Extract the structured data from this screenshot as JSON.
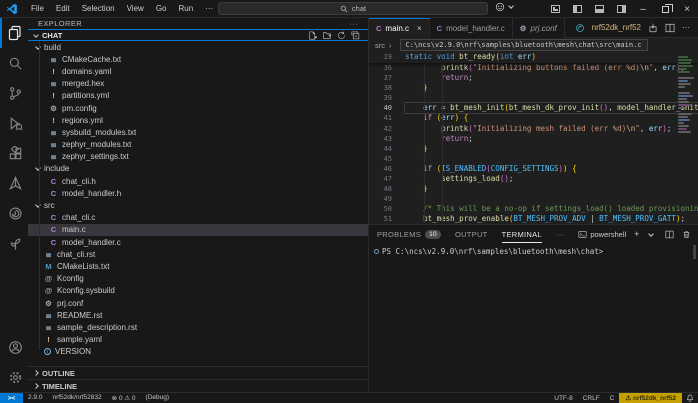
{
  "icons": {
    "more": "···",
    "close": "×",
    "back": "←",
    "forward": "→",
    "minimize": "–",
    "crumb_chevron": "›",
    "plus": "+",
    "remote": "><"
  },
  "title_bar": {
    "menus": [
      "File",
      "Edit",
      "Selection",
      "View",
      "Go",
      "Run"
    ],
    "search_value": "chat"
  },
  "explorer": {
    "title": "EXPLORER",
    "section": "CHAT",
    "outline": "OUTLINE",
    "timeline": "TIMELINE",
    "tree": [
      {
        "label": "build",
        "kind": "folder",
        "depth": 1
      },
      {
        "label": "CMakeCache.txt",
        "icon": "file",
        "depth": 2
      },
      {
        "label": "domains.yaml",
        "icon": "excl",
        "depth": 2
      },
      {
        "label": "merged.hex",
        "icon": "file",
        "depth": 2
      },
      {
        "label": "partitions.yml",
        "icon": "excl",
        "depth": 2
      },
      {
        "label": "pm.config",
        "icon": "gear",
        "depth": 2
      },
      {
        "label": "regions.yml",
        "icon": "excl",
        "depth": 2
      },
      {
        "label": "sysbuild_modules.txt",
        "icon": "file",
        "depth": 2
      },
      {
        "label": "zephyr_modules.txt",
        "icon": "file",
        "depth": 2
      },
      {
        "label": "zephyr_settings.txt",
        "icon": "file",
        "depth": 2
      },
      {
        "label": "include",
        "kind": "folder",
        "depth": 1
      },
      {
        "label": "chat_cli.h",
        "icon": "c",
        "depth": 2
      },
      {
        "label": "model_handler.h",
        "icon": "c",
        "depth": 2
      },
      {
        "label": "src",
        "kind": "folder",
        "depth": 1
      },
      {
        "label": "chat_cli.c",
        "icon": "c",
        "depth": 2
      },
      {
        "label": "main.c",
        "icon": "c",
        "depth": 2,
        "selected": true
      },
      {
        "label": "model_handler.c",
        "icon": "c",
        "depth": 2
      },
      {
        "label": "chat_cli.rst",
        "icon": "file",
        "depth": 1
      },
      {
        "label": "CMakeLists.txt",
        "icon": "cmake",
        "depth": 1
      },
      {
        "label": "Kconfig",
        "icon": "kcfg",
        "depth": 1
      },
      {
        "label": "Kconfig.sysbuild",
        "icon": "kcfg",
        "depth": 1
      },
      {
        "label": "prj.conf",
        "icon": "gear",
        "depth": 1
      },
      {
        "label": "README.rst",
        "icon": "file",
        "depth": 1
      },
      {
        "label": "sample_description.rst",
        "icon": "file",
        "depth": 1
      },
      {
        "label": "sample.yaml",
        "icon": "excl",
        "depth": 1
      },
      {
        "label": "VERSION",
        "icon": "info",
        "depth": 1
      }
    ]
  },
  "tabs": {
    "items": [
      {
        "label": "main.c",
        "icon": "c",
        "active": true
      },
      {
        "label": "model_handler.c",
        "icon": "c"
      },
      {
        "label": "prj.conf",
        "icon": "gear",
        "preview": true
      }
    ],
    "board": "nrf52dk_nrf52"
  },
  "breadcrumb": {
    "folder": "src",
    "path": "C:\\ncs\\v2.9.0\\nrf\\samples\\bluetooth\\mesh\\chat\\src\\main.c"
  },
  "editor": {
    "sticky": {
      "n": "19",
      "t": [
        [
          "kw",
          "static"
        ],
        [
          "pln",
          " "
        ],
        [
          "kw",
          "void"
        ],
        [
          "fn",
          " bt_ready"
        ],
        [
          "b1",
          "("
        ],
        [
          "kw",
          "int"
        ],
        [
          "var",
          " err"
        ],
        [
          "b1",
          ")"
        ]
      ]
    },
    "lines": [
      {
        "n": "36",
        "t": [
          [
            "ws",
            "        "
          ],
          [
            "fn",
            "printk"
          ],
          [
            "b2",
            "("
          ],
          [
            "str",
            "\"Initializing buttons failed (err %d)"
          ],
          [
            "esc",
            "\\n"
          ],
          [
            "str",
            "\""
          ],
          [
            "pln",
            ", "
          ],
          [
            "var",
            "err"
          ],
          [
            "b2",
            ")"
          ],
          [
            "pln",
            ";"
          ]
        ]
      },
      {
        "n": "37",
        "t": [
          [
            "ws",
            "        "
          ],
          [
            "ctl",
            "return"
          ],
          [
            "pln",
            ";"
          ]
        ]
      },
      {
        "n": "38",
        "t": [
          [
            "ws",
            "    "
          ],
          [
            "b1",
            "}"
          ]
        ]
      },
      {
        "n": "39",
        "t": []
      },
      {
        "n": "40",
        "cur": true,
        "t": [
          [
            "ws",
            "    "
          ],
          [
            "var",
            "err"
          ],
          [
            "pln",
            " = "
          ],
          [
            "fn",
            "bt_mesh_init"
          ],
          [
            "b1",
            "("
          ],
          [
            "fn",
            "bt_mesh_dk_prov_init"
          ],
          [
            "b2",
            "()"
          ],
          [
            "pln",
            ", "
          ],
          [
            "fn",
            "model_handler_init"
          ],
          [
            "b2",
            "()"
          ],
          [
            "b1",
            ")"
          ],
          [
            "pln",
            ";"
          ]
        ]
      },
      {
        "n": "41",
        "t": [
          [
            "ws",
            "    "
          ],
          [
            "ctl",
            "if"
          ],
          [
            "pln",
            " "
          ],
          [
            "b1",
            "("
          ],
          [
            "var",
            "err"
          ],
          [
            "b1",
            ")"
          ],
          [
            "pln",
            " "
          ],
          [
            "b1",
            "{"
          ]
        ]
      },
      {
        "n": "42",
        "t": [
          [
            "ws",
            "        "
          ],
          [
            "fn",
            "printk"
          ],
          [
            "b2",
            "("
          ],
          [
            "str",
            "\"Initializing mesh failed (err %d)"
          ],
          [
            "esc",
            "\\n"
          ],
          [
            "str",
            "\""
          ],
          [
            "pln",
            ", "
          ],
          [
            "var",
            "err"
          ],
          [
            "b2",
            ")"
          ],
          [
            "pln",
            ";"
          ]
        ]
      },
      {
        "n": "43",
        "t": [
          [
            "ws",
            "        "
          ],
          [
            "ctl",
            "return"
          ],
          [
            "pln",
            ";"
          ]
        ]
      },
      {
        "n": "44",
        "t": [
          [
            "ws",
            "    "
          ],
          [
            "b1",
            "}"
          ]
        ]
      },
      {
        "n": "45",
        "t": []
      },
      {
        "n": "46",
        "t": [
          [
            "ws",
            "    "
          ],
          [
            "ctl",
            "if"
          ],
          [
            "pln",
            " "
          ],
          [
            "b1",
            "("
          ],
          [
            "mac",
            "IS_ENABLED"
          ],
          [
            "b2",
            "("
          ],
          [
            "mac",
            "CONFIG_SETTINGS"
          ],
          [
            "b2",
            ")"
          ],
          [
            "b1",
            ")"
          ],
          [
            "pln",
            " "
          ],
          [
            "b1",
            "{"
          ]
        ]
      },
      {
        "n": "47",
        "t": [
          [
            "ws",
            "        "
          ],
          [
            "fn",
            "settings_load"
          ],
          [
            "b2",
            "()"
          ],
          [
            "pln",
            ";"
          ]
        ]
      },
      {
        "n": "48",
        "t": [
          [
            "ws",
            "    "
          ],
          [
            "b1",
            "}"
          ]
        ]
      },
      {
        "n": "49",
        "t": []
      },
      {
        "n": "50",
        "t": [
          [
            "ws",
            "    "
          ],
          [
            "cmt",
            "/* This will be a no-op if settings_load() loaded provisioning info */"
          ]
        ]
      },
      {
        "n": "51",
        "t": [
          [
            "ws",
            "    "
          ],
          [
            "fn",
            "bt_mesh_prov_enable"
          ],
          [
            "b1",
            "("
          ],
          [
            "mac",
            "BT_MESH_PROV_ADV"
          ],
          [
            "pln",
            " | "
          ],
          [
            "mac",
            "BT_MESH_PROV_GATT"
          ],
          [
            "b1",
            ")"
          ],
          [
            "pln",
            ";"
          ]
        ]
      }
    ]
  },
  "minimap": {
    "marks": [
      [
        4,
        10,
        "g"
      ],
      [
        7,
        14,
        "g"
      ],
      [
        10,
        13,
        "g"
      ],
      [
        13,
        15,
        "g"
      ],
      [
        16,
        9,
        "g"
      ],
      [
        19,
        12,
        "g"
      ],
      [
        25,
        16,
        "n"
      ],
      [
        28,
        10,
        "b"
      ],
      [
        31,
        13,
        "n"
      ],
      [
        34,
        7,
        "n"
      ],
      [
        40,
        12,
        "n"
      ],
      [
        43,
        15,
        "b"
      ],
      [
        46,
        9,
        "n"
      ],
      [
        49,
        11,
        "n"
      ],
      [
        52,
        13,
        "p"
      ],
      [
        55,
        8,
        "n"
      ],
      [
        61,
        14,
        "n"
      ],
      [
        64,
        10,
        "n"
      ],
      [
        67,
        12,
        "b"
      ],
      [
        70,
        6,
        "n"
      ],
      [
        73,
        11,
        "n"
      ],
      [
        76,
        9,
        "p"
      ],
      [
        79,
        13,
        "n"
      ]
    ]
  },
  "panel": {
    "tabs": [
      {
        "label": "PROBLEMS",
        "badge": "10"
      },
      {
        "label": "OUTPUT"
      },
      {
        "label": "TERMINAL",
        "active": true
      }
    ],
    "shell_label": "powershell",
    "terminal_line": "PS C:\\ncs\\v2.9.0\\nrf\\samples\\bluetooth\\mesh\\chat>"
  },
  "status_bar": {
    "left": [
      "2.9.0",
      "nrf52dk/nrf52832",
      "⊗ 0 ⚠ 0",
      "(Debug)"
    ],
    "right": [
      "UTF-8",
      "CRLF",
      "C"
    ],
    "badge": "⚠ nrf52dk_nrf52"
  },
  "colors": {
    "accent": "#0078d4",
    "c_file": "#b180d7",
    "warn_file": "#e2c08d",
    "cmake_file": "#519aba",
    "badge_bg": "#c4a000"
  }
}
